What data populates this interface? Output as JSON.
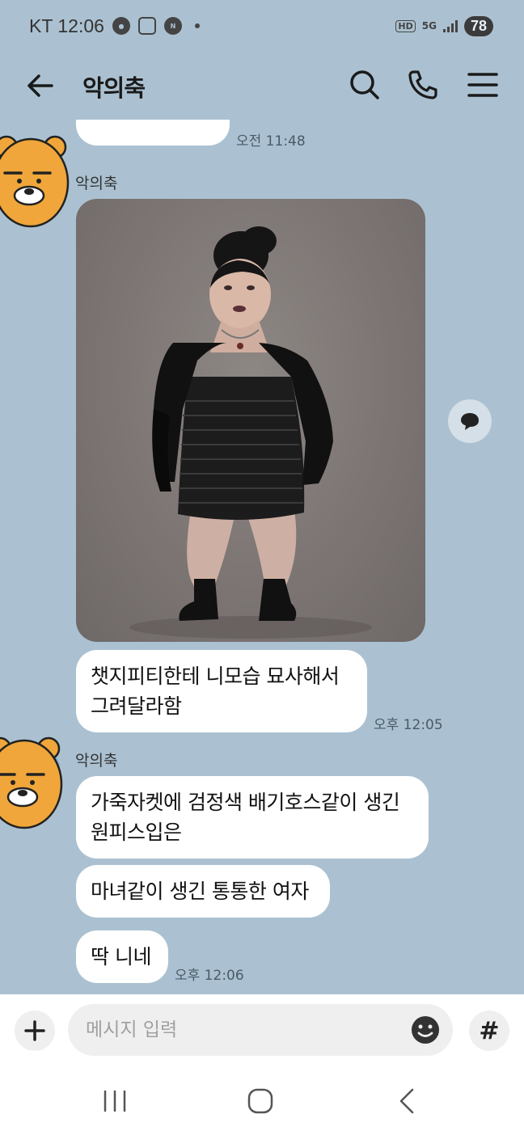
{
  "status_bar": {
    "carrier": "KT",
    "time": "12:06",
    "battery": "78",
    "hd_label": "HD",
    "network_label": "5G"
  },
  "header": {
    "title": "악의축",
    "icons": [
      "back-arrow-icon",
      "search-icon",
      "phone-icon",
      "menu-icon"
    ]
  },
  "messages": [
    {
      "type": "text",
      "text": "...",
      "time": "오전 11:48",
      "partial": true
    },
    {
      "type": "photo",
      "sender": "악의축"
    },
    {
      "type": "text",
      "text": "챗지피티한테 니모습 묘사해서\n그려달라함",
      "time": "오후 12:05"
    },
    {
      "type": "text",
      "sender": "악의축",
      "text": "가죽자켓에 검정색 배기호스같이 생긴\n원피스입은"
    },
    {
      "type": "text",
      "text": "마녀같이 생긴 통통한 여자"
    },
    {
      "type": "text",
      "text": "딱 니네",
      "time": "오후 12:06"
    }
  ],
  "input": {
    "placeholder": "메시지 입력",
    "value": ""
  },
  "colors": {
    "background": "#abc1d1",
    "bubble": "#ffffff",
    "avatar": "#f0a63a"
  }
}
